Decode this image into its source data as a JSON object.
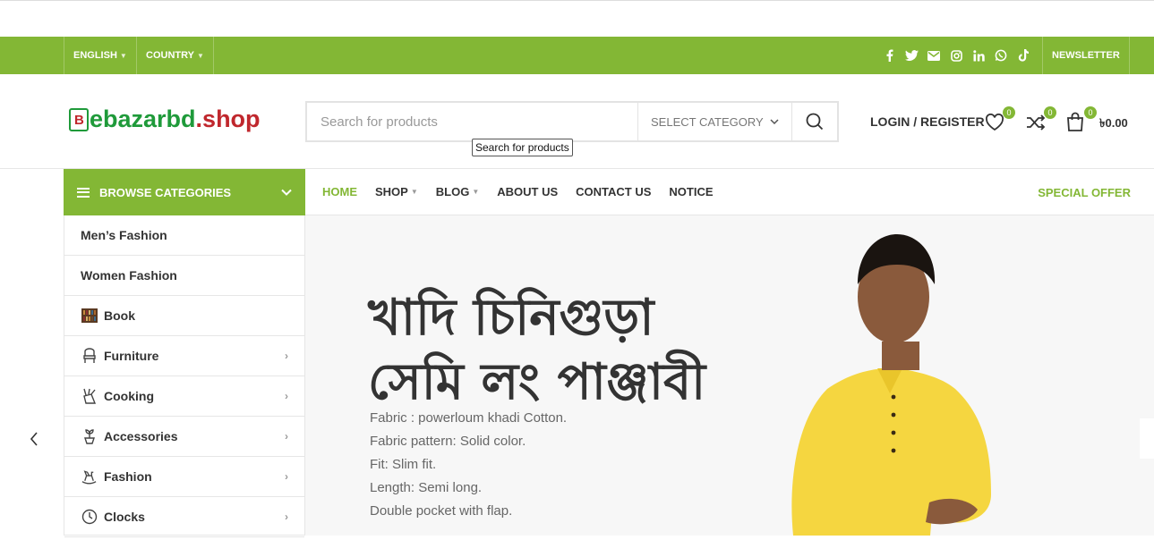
{
  "topbar": {
    "language": "ENGLISH",
    "country": "COUNTRY",
    "newsletter": "NEWSLETTER",
    "socials": [
      "facebook-icon",
      "twitter-icon",
      "email-icon",
      "instagram-icon",
      "linkedin-icon",
      "whatsapp-icon",
      "tiktok-icon"
    ],
    "color": "#83b735"
  },
  "header": {
    "logo_prefix": "ebazarbd",
    "logo_suffix": ".shop",
    "logo_bag_letter": "B",
    "search_placeholder": "Search for products",
    "search_tooltip": "Search for products",
    "category_select": "SELECT CATEGORY",
    "login": "LOGIN / REGISTER",
    "wishlist_count": "0",
    "compare_count": "0",
    "cart_count": "0",
    "cart_total": "৳0.00"
  },
  "browse": {
    "label": "BROWSE CATEGORIES"
  },
  "nav": {
    "items": [
      {
        "label": "HOME"
      },
      {
        "label": "SHOP"
      },
      {
        "label": "BLOG"
      },
      {
        "label": "ABOUT US"
      },
      {
        "label": "CONTACT US"
      },
      {
        "label": "NOTICE"
      }
    ],
    "special": "SPECIAL OFFER"
  },
  "categories": [
    {
      "label": "Men’s Fashion"
    },
    {
      "label": "Women Fashion"
    },
    {
      "label": "Book"
    },
    {
      "label": "Furniture"
    },
    {
      "label": "Cooking"
    },
    {
      "label": "Accessories"
    },
    {
      "label": "Fashion"
    },
    {
      "label": "Clocks"
    }
  ],
  "banner": {
    "title_line1": "খাদি চিনিগুড়া",
    "title_line2": "সেমি লং পাঞ্জাবী",
    "specs": [
      "Fabric : powerloum khadi Cotton.",
      "Fabric pattern: Solid color.",
      "Fit: Slim fit.",
      "Length: Semi long.",
      "Double pocket with flap."
    ]
  }
}
